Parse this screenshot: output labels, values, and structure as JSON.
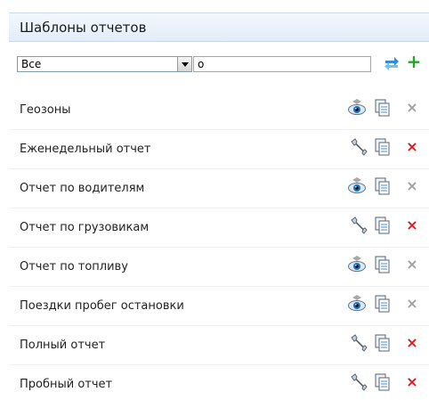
{
  "header": {
    "title": "Шаблоны отчетов"
  },
  "filter": {
    "select_value": "Все",
    "search_value": "о"
  },
  "icons": {
    "view": "eye-icon",
    "edit": "wrench-icon",
    "copy": "copy-icon",
    "delete": "close-icon",
    "swap": "swap-arrows-icon",
    "add": "plus-icon"
  },
  "colors": {
    "delete_active": "#e01717",
    "delete_disabled": "#a0a0a0",
    "add": "#27a42a",
    "header_bg": "#e3edf8"
  },
  "rows": [
    {
      "name": "Геозоны",
      "editable": false
    },
    {
      "name": "Еженедельный отчет",
      "editable": true
    },
    {
      "name": "Отчет по водителям",
      "editable": false
    },
    {
      "name": "Отчет по грузовикам",
      "editable": true
    },
    {
      "name": "Отчет по топливу",
      "editable": false
    },
    {
      "name": "Поездки пробег остановки",
      "editable": false
    },
    {
      "name": "Полный отчет",
      "editable": true
    },
    {
      "name": "Пробный отчет",
      "editable": true
    }
  ]
}
